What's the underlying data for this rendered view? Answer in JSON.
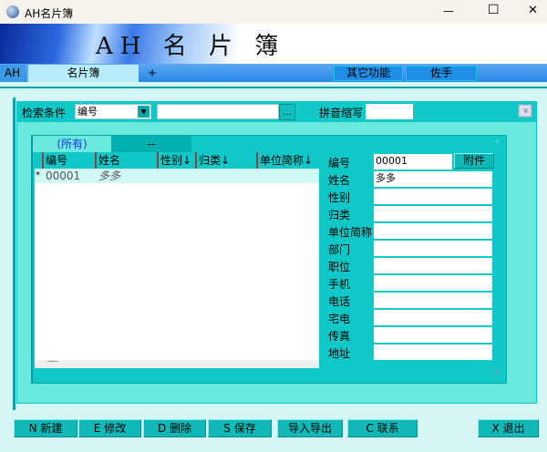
{
  "window": {
    "title": "AH名片簿",
    "minimize": "—",
    "maximize": "☐",
    "close": "✕"
  },
  "banner": {
    "title": "AH 名 片 簿"
  },
  "tabs": {
    "ah": "AH",
    "main": "名片簿",
    "add": "+",
    "other": "其它功能",
    "assistant": "佐手"
  },
  "search": {
    "label": "检索条件",
    "field_value": "编号",
    "keyword": "",
    "browse": "...",
    "pinyin_label": "拼音缩写",
    "pinyin_value": "",
    "collapse": "»"
  },
  "grid": {
    "tabs": [
      "(所有)",
      "--"
    ],
    "columns": [
      "编号",
      "姓名",
      "性别↓",
      "归类↓",
      "单位简称↓"
    ],
    "rows": [
      {
        "marker": "*",
        "id": "00001",
        "name": "多多"
      }
    ],
    "footer_marker": "—",
    "star": "*"
  },
  "detail": {
    "fields": [
      {
        "label": "编号",
        "value": "00001"
      },
      {
        "label": "姓名",
        "value": "多多"
      },
      {
        "label": "性别",
        "value": ""
      },
      {
        "label": "归类",
        "value": ""
      },
      {
        "label": "单位简称",
        "value": ""
      },
      {
        "label": "部门",
        "value": ""
      },
      {
        "label": "职位",
        "value": ""
      },
      {
        "label": "手机",
        "value": ""
      },
      {
        "label": "电话",
        "value": ""
      },
      {
        "label": "宅电",
        "value": ""
      },
      {
        "label": "传真",
        "value": ""
      },
      {
        "label": "地址",
        "value": ""
      }
    ],
    "attach": "附件"
  },
  "buttons": {
    "new": "N 新建",
    "edit": "E 修改",
    "delete": "D 删除",
    "save": "S 保存",
    "import": "导入导出",
    "contact": "C 联系",
    "exit": "X 退出"
  }
}
